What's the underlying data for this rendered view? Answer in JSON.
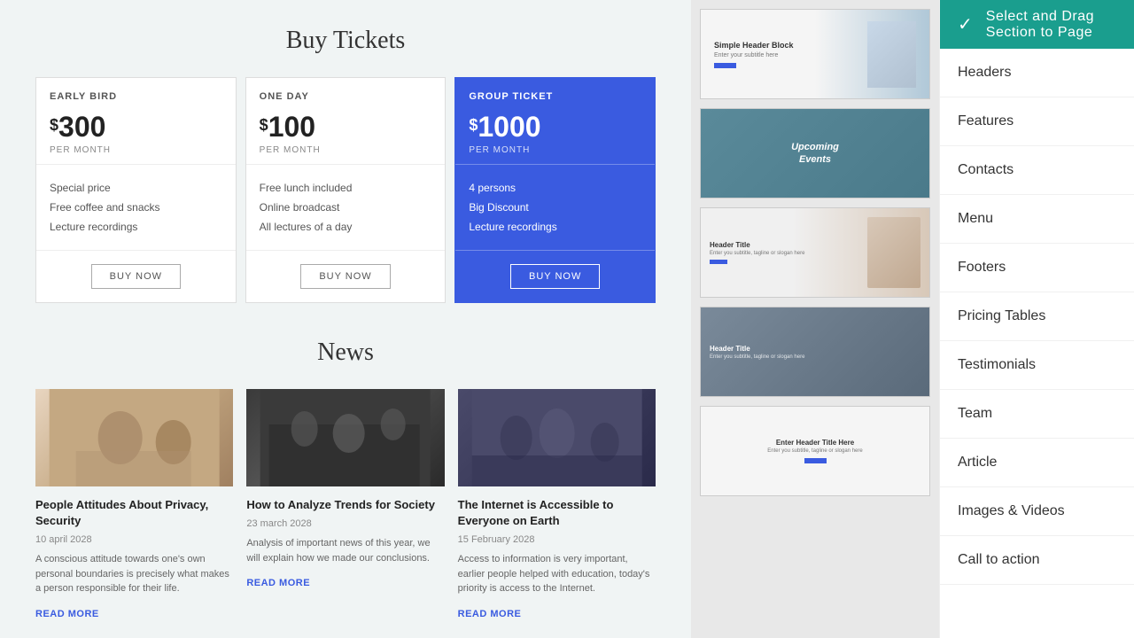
{
  "main": {
    "tickets_title": "Buy Tickets",
    "pricing": [
      {
        "label": "EARLY BIRD",
        "currency": "$",
        "price": "300",
        "period": "PER MONTH",
        "features": [
          "Special price",
          "Free coffee and snacks",
          "Lecture recordings"
        ],
        "button": "BUY NOW",
        "highlighted": false
      },
      {
        "label": "ONE DAY",
        "currency": "$",
        "price": "100",
        "period": "PER MONTH",
        "features": [
          "Free lunch included",
          "Online broadcast",
          "All lectures of a day"
        ],
        "button": "BUY NOW",
        "highlighted": false
      },
      {
        "label": "GROUP TICKET",
        "currency": "$",
        "price": "1000",
        "period": "PER MONTH",
        "features": [
          "4 persons",
          "Big Discount",
          "Lecture recordings"
        ],
        "button": "BUY NOW",
        "highlighted": true
      }
    ],
    "news_title": "News",
    "news": [
      {
        "title": "People Attitudes About Privacy, Security",
        "date": "10 april 2028",
        "excerpt": "A conscious attitude towards one's own personal boundaries is precisely what makes a person responsible for their life.",
        "read_more": "READ MORE",
        "img_class": "news-img-1"
      },
      {
        "title": "How to Analyze Trends for Society",
        "date": "23 march 2028",
        "excerpt": "Analysis of important news of this year, we will explain how we made our conclusions.",
        "read_more": "READ MORE",
        "img_class": "news-img-2"
      },
      {
        "title": "The Internet is Accessible to Everyone on Earth",
        "date": "15 February 2028",
        "excerpt": "Access to information is very important, earlier people helped with education, today's priority is access to the Internet.",
        "read_more": "READ MORE",
        "img_class": "news-img-3"
      }
    ]
  },
  "topbar": {
    "title": "Select and  Drag Section to  Page",
    "check": "✓"
  },
  "categories": [
    {
      "id": "headers",
      "label": "Headers"
    },
    {
      "id": "features",
      "label": "Features"
    },
    {
      "id": "contacts",
      "label": "Contacts"
    },
    {
      "id": "menu",
      "label": "Menu"
    },
    {
      "id": "footers",
      "label": "Footers"
    },
    {
      "id": "pricing-tables",
      "label": "Pricing Tables"
    },
    {
      "id": "testimonials",
      "label": "Testimonials"
    },
    {
      "id": "team",
      "label": "Team"
    },
    {
      "id": "article",
      "label": "Article"
    },
    {
      "id": "images-videos",
      "label": "Images & Videos"
    },
    {
      "id": "call-to-action",
      "label": "Call to action"
    }
  ],
  "thumbnails": [
    {
      "id": "thumb-1",
      "type": "simple-header",
      "title": "Simple Header Block",
      "subtitle": "Enter your subtitle here"
    },
    {
      "id": "thumb-2",
      "type": "events",
      "title": "Upcoming Events"
    },
    {
      "id": "thumb-3",
      "type": "features",
      "title": "Header Title",
      "subtitle": "Enter you subtitle, tagline or slogan here"
    },
    {
      "id": "thumb-4",
      "type": "team",
      "title": "Header Title",
      "subtitle": "Enter you subtitle, tagline or slogan here"
    },
    {
      "id": "thumb-5",
      "type": "cta",
      "title": "Enter Header Title Here",
      "subtitle": "Enter you subtitle, tagline or slogan here"
    }
  ]
}
